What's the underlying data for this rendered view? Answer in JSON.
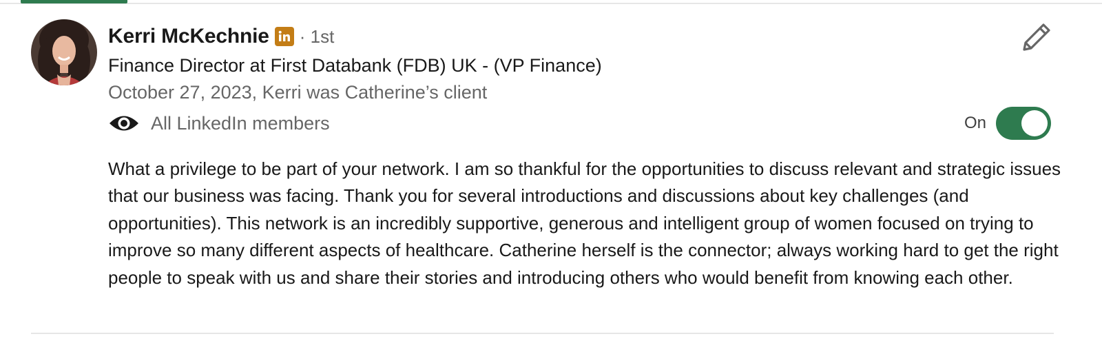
{
  "recommendation": {
    "author_name": "Kerri McKechnie",
    "degree": "· 1st",
    "headline": "Finance Director at First Databank (FDB) UK - (VP Finance)",
    "meta": "October 27, 2023, Kerri was Catherine’s client",
    "visibility_label": "All LinkedIn members",
    "toggle_label": "On",
    "toggle_on": true,
    "body": "What a privilege to be part of your network. I am so thankful for the opportunities to discuss relevant and strategic issues that our business was facing. Thank you for several introductions and discussions about key challenges (and opportunities). This network is an incredibly supportive, generous and intelligent group of women focused on trying to improve so many different aspects of healthcare. Catherine herself is the connector; always working hard to get the right people to speak with us and share their stories and introducing others who would benefit from knowing each other."
  },
  "icons": {
    "edit": "pencil-icon",
    "visibility": "eye-icon",
    "badge": "linkedin-premium-icon"
  },
  "colors": {
    "accent_green": "#2e7b4f",
    "premium_gold": "#c37d16",
    "text_primary": "#191919",
    "text_secondary": "#666666"
  }
}
